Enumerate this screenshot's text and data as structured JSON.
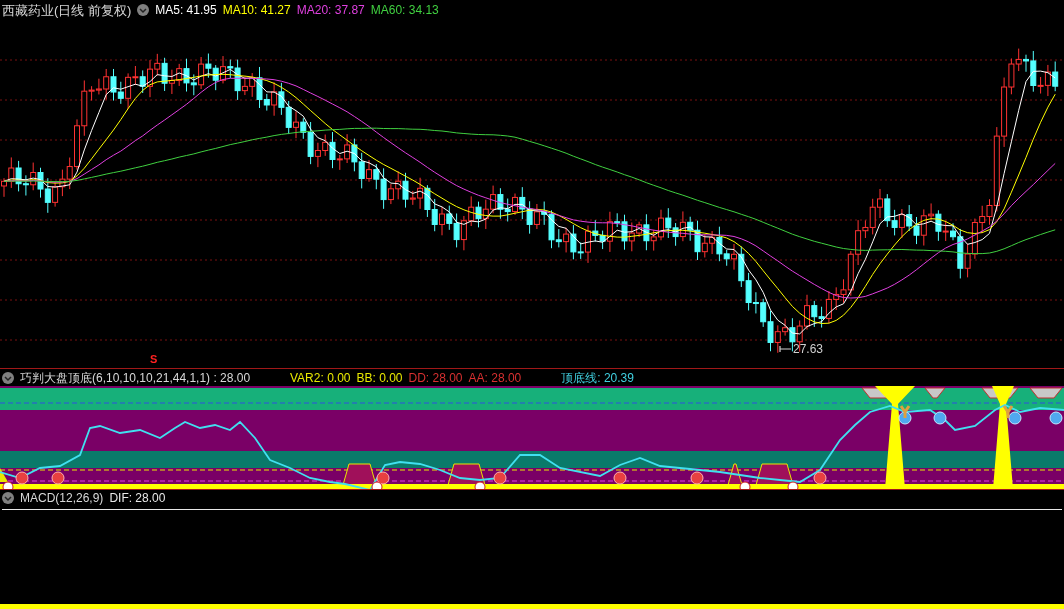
{
  "stock": {
    "name": "西藏药业(日线 前复权)",
    "ma": [
      {
        "label": "MA5: 41.95",
        "color": "#ffffff"
      },
      {
        "label": "MA10: 41.27",
        "color": "#ffff00"
      },
      {
        "label": "MA20: 37.87",
        "color": "#e040e0"
      },
      {
        "label": "MA60: 34.13",
        "color": "#40d040"
      }
    ]
  },
  "price_chart": {
    "low_label": "27.63"
  },
  "indicator": {
    "marker": "S",
    "title": "巧判大盘顶底(6,10,10,10,21,44,1,1)  : 28.00",
    "values": [
      {
        "label": "VAR2: 0.00",
        "color": "#e8e800"
      },
      {
        "label": "BB: 0.00",
        "color": "#e8e800"
      },
      {
        "label": "DD: 28.00",
        "color": "#d83030"
      },
      {
        "label": "AA: 28.00",
        "color": "#d83030"
      }
    ],
    "line_label": "顶底线: 20.39"
  },
  "macd": {
    "title": "MACD(12,26,9)",
    "dif": "DIF: 28.00"
  }
}
